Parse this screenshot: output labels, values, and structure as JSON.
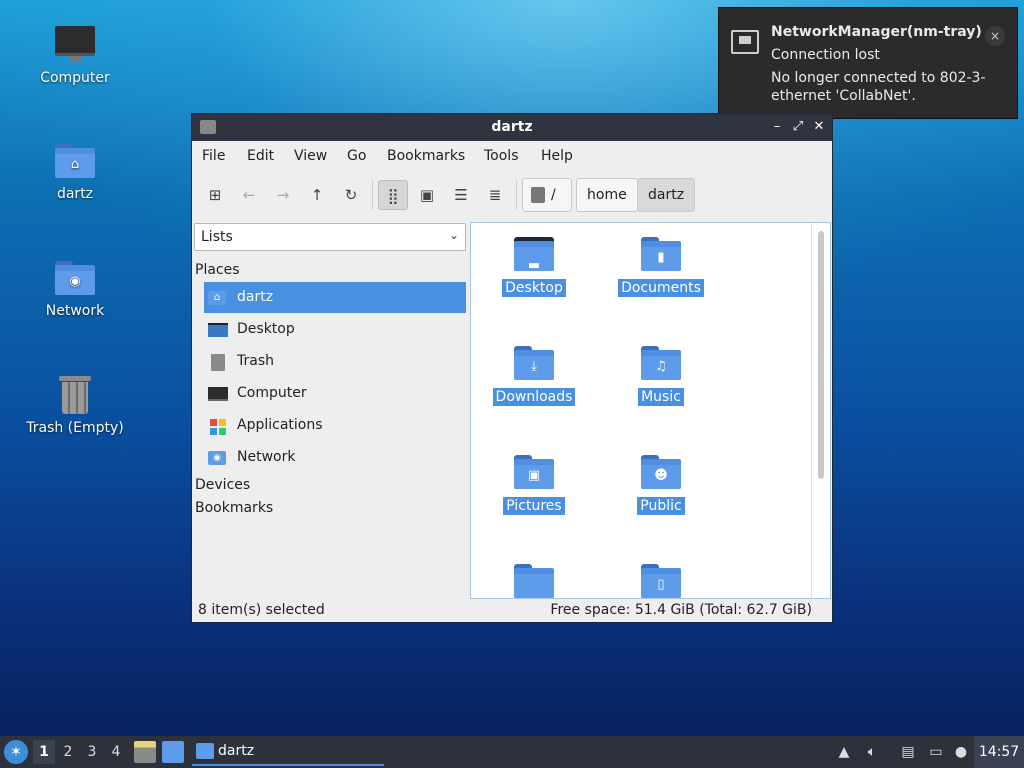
{
  "desktop": {
    "icons": [
      {
        "label": "Computer",
        "icon": "computer-icon"
      },
      {
        "label": "dartz",
        "icon": "home-folder-icon"
      },
      {
        "label": "Network",
        "icon": "network-folder-icon"
      },
      {
        "label": "Trash (Empty)",
        "icon": "trash-icon"
      }
    ]
  },
  "notification": {
    "app": "NetworkManager(nm-tray)",
    "summary": "Connection lost",
    "body": "No longer connected to 802-3-ethernet 'CollabNet'.",
    "close": "×",
    "icon": "network-wired-icon"
  },
  "window": {
    "title": "dartz",
    "controls": {
      "minimize": "–",
      "maximize": "⤢",
      "close": "✕"
    },
    "menu": [
      "File",
      "Edit",
      "View",
      "Go",
      "Bookmarks",
      "Tools",
      "Help"
    ],
    "toolbar": {
      "icons": [
        "new-tab-icon",
        "back-icon",
        "forward-icon",
        "up-icon",
        "reload-icon",
        "icon-view-icon",
        "thumbnail-view-icon",
        "compact-view-icon",
        "detailed-list-view-icon"
      ],
      "glyphs": {
        "back": "←",
        "forward": "→",
        "up": "↑",
        "reload": "↻",
        "icon_view": "⣿",
        "thumb_view": "▣",
        "compact_view": "☰",
        "list_view": "≣",
        "new_tab": "⊞"
      },
      "breadcrumb": [
        "/",
        "home",
        "dartz"
      ]
    },
    "sidebar": {
      "mode": "Lists",
      "places_heading": "Places",
      "places": [
        {
          "label": "dartz",
          "icon": "home-folder-icon",
          "selected": true
        },
        {
          "label": "Desktop",
          "icon": "desktop-icon",
          "selected": false
        },
        {
          "label": "Trash",
          "icon": "trash-icon",
          "selected": false
        },
        {
          "label": "Computer",
          "icon": "computer-icon",
          "selected": false
        },
        {
          "label": "Applications",
          "icon": "applications-icon",
          "selected": false
        },
        {
          "label": "Network",
          "icon": "network-folder-icon",
          "selected": false
        }
      ],
      "devices_heading": "Devices",
      "bookmarks_heading": "Bookmarks"
    },
    "files": [
      {
        "label": "Desktop",
        "icon": "desktop-folder-icon"
      },
      {
        "label": "Documents",
        "icon": "documents-folder-icon"
      },
      {
        "label": "Downloads",
        "icon": "downloads-folder-icon"
      },
      {
        "label": "Music",
        "icon": "music-folder-icon"
      },
      {
        "label": "Pictures",
        "icon": "pictures-folder-icon"
      },
      {
        "label": "Public",
        "icon": "public-folder-icon"
      },
      {
        "label": "",
        "icon": "templates-folder-icon"
      },
      {
        "label": "",
        "icon": "videos-folder-icon"
      }
    ],
    "status": {
      "left": "8 item(s) selected",
      "right": "Free space: 51.4 GiB (Total: 62.7 GiB)"
    }
  },
  "taskbar": {
    "workspaces": [
      "1",
      "2",
      "3",
      "4"
    ],
    "current_workspace": "1",
    "task_label": "dartz",
    "clock": "14:57",
    "tray_icons": [
      "tray-up-arrow-icon",
      "volume-icon",
      "clipboard-icon",
      "network-icon",
      "update-notifier-icon"
    ]
  },
  "colors": {
    "selection": "#4a90e2",
    "titlebar": "#2f3440",
    "taskbar": "#2c313c",
    "folder": "#5e9bea"
  }
}
